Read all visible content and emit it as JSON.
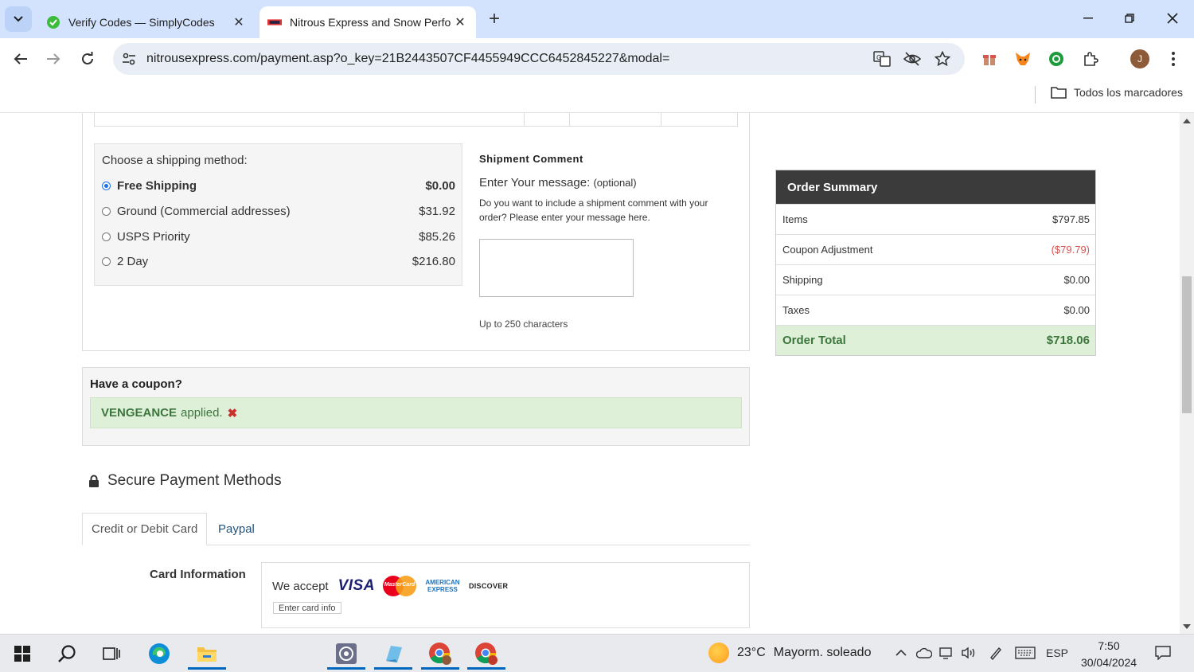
{
  "browser": {
    "tabs": [
      {
        "title": "Verify Codes — SimplyCodes",
        "active": false
      },
      {
        "title": "Nitrous Express and Snow Perfo",
        "active": true
      }
    ],
    "url": "nitrousexpress.com/payment.asp?o_key=21B2443507CF4455949CCC6452845227&modal=",
    "bookmarks_label": "Todos los marcadores",
    "profile_initial": "J"
  },
  "shipping": {
    "heading": "Choose a shipping method:",
    "options": [
      {
        "label": "Free Shipping",
        "price": "$0.00",
        "selected": true
      },
      {
        "label": "Ground (Commercial addresses)",
        "price": "$31.92",
        "selected": false
      },
      {
        "label": "USPS Priority",
        "price": "$85.26",
        "selected": false
      },
      {
        "label": "2 Day",
        "price": "$216.80",
        "selected": false
      }
    ]
  },
  "comment": {
    "title": "Shipment Comment",
    "prompt": "Enter Your message:",
    "optional": "(optional)",
    "description": "Do you want to include a shipment comment with your order? Please enter your message here.",
    "limit": "Up to 250 characters"
  },
  "coupon": {
    "title": "Have a coupon?",
    "code": "VENGEANCE",
    "status": "applied.",
    "remove_glyph": "✖"
  },
  "payment": {
    "title": "Secure Payment Methods",
    "tabs": [
      "Credit or Debit Card",
      "Paypal"
    ],
    "card_label": "Card Information",
    "we_accept": "We accept",
    "brands": {
      "visa": "VISA",
      "mastercard": "MasterCard",
      "amex_top": "AMERICAN",
      "amex_bottom": "EXPRESS",
      "discover": "DISCOVER"
    },
    "enter_card": "Enter card info"
  },
  "summary": {
    "title": "Order Summary",
    "rows": [
      {
        "label": "Items",
        "value": "$797.85"
      },
      {
        "label": "Coupon Adjustment",
        "value": "($79.79)"
      },
      {
        "label": "Shipping",
        "value": "$0.00"
      },
      {
        "label": "Taxes",
        "value": "$0.00"
      }
    ],
    "total_label": "Order Total",
    "total_value": "$718.06"
  },
  "taskbar": {
    "weather_temp": "23°C",
    "weather_desc": "Mayorm. soleado",
    "lang": "ESP",
    "time": "7:50",
    "date": "30/04/2024"
  },
  "colors": {
    "accent": "#1a73e8",
    "success_bg": "#dff0d8",
    "success_text": "#3c763d",
    "negative": "#d9534f",
    "summary_header": "#3b3b3b"
  }
}
